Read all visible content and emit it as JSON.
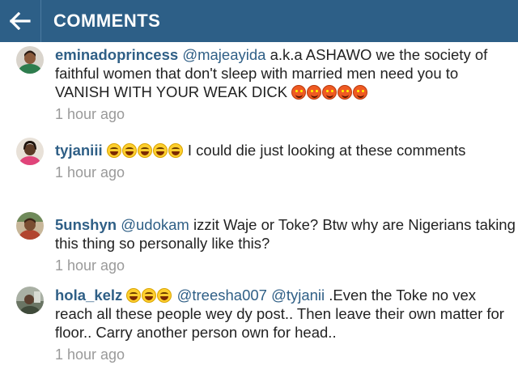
{
  "header": {
    "title": "COMMENTS",
    "back_icon": "arrow-left-icon",
    "bar_color": "#2d5f87"
  },
  "comments": [
    {
      "username": "eminadoprincess",
      "mention": "@majeayida",
      "text": "a.k.a ASHAWO we the society of faithful women that don't sleep with married men need you to VANISH WITH YOUR WEAK DICK",
      "emoji": "smiling-devil-icon",
      "emoji_count": 5,
      "time": "1 hour ago"
    },
    {
      "username": "tyjaniii",
      "emoji": "laughing-face-icon",
      "emoji_count": 5,
      "text": "I could die just looking at these comments",
      "time": "1 hour ago"
    },
    {
      "username": "5unshyn",
      "mention": "@udokam",
      "text": "izzit Waje or Toke? Btw why are Nigerians taking this thing so personally like this?",
      "time": "1 hour ago"
    },
    {
      "username": "hola_kelz",
      "emoji": "laughing-face-icon",
      "emoji_count": 3,
      "mention": "@treesha007 @tyjanii",
      "text": ".Even the Toke no vex reach all these people wey dy post.. Then leave their own matter for floor.. Carry another person own for head..",
      "time": "1 hour ago"
    }
  ]
}
